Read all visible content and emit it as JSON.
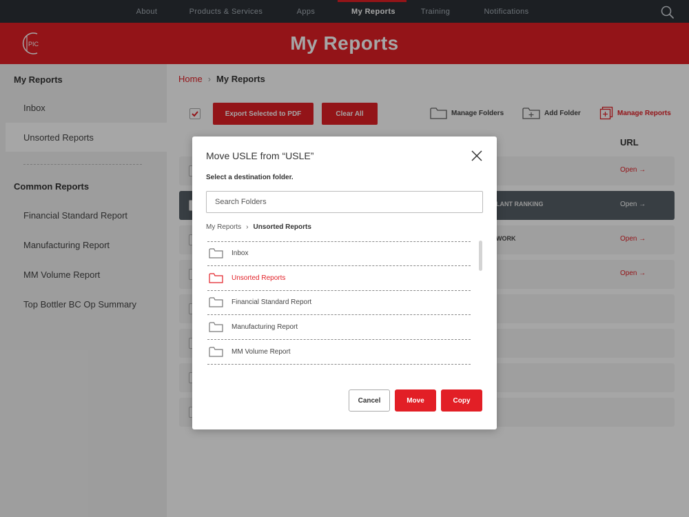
{
  "nav": {
    "items": [
      {
        "label": "About",
        "active": false
      },
      {
        "label": "Products & Services",
        "active": false
      },
      {
        "label": "Apps",
        "active": false
      },
      {
        "label": "My Reports",
        "active": true
      },
      {
        "label": "Training",
        "active": false
      },
      {
        "label": "Notifications",
        "active": false
      }
    ],
    "search_icon": "search-icon"
  },
  "header": {
    "logo_text": "PIC",
    "title": "My Reports"
  },
  "sidebar": {
    "my_reports_heading": "My Reports",
    "my_reports_items": [
      {
        "label": "Inbox"
      },
      {
        "label": "Unsorted Reports",
        "selected": true
      }
    ],
    "common_reports_heading": "Common Reports",
    "common_reports_items": [
      {
        "label": "Financial Standard Report"
      },
      {
        "label": "Manufacturing Report"
      },
      {
        "label": "MM Volume Report"
      },
      {
        "label": "Top Bottler BC Op Summary"
      }
    ]
  },
  "main": {
    "breadcrumb": {
      "home": "Home",
      "separator": "›",
      "current": "My Reports"
    },
    "toolbar": {
      "export_label": "Export Selected to PDF",
      "clear_label": "Clear All",
      "manage_folders_label": "Manage Folders",
      "add_folder_label": "Add Folder",
      "manage_reports_label": "Manage Reports"
    },
    "table": {
      "url_header": "URL",
      "rows": [
        {
          "name": "",
          "url": "Open →"
        },
        {
          "name": "LANT RANKING",
          "url": "Open →",
          "highlighted": true
        },
        {
          "name": "WORK",
          "url": "Open →"
        },
        {
          "name": "",
          "url": "Open →"
        },
        {
          "name": "",
          "url": ""
        },
        {
          "name": "",
          "url": ""
        },
        {
          "name": "",
          "url": ""
        },
        {
          "name": "",
          "url": ""
        }
      ]
    }
  },
  "modal": {
    "title": "Move USLE from “USLE”",
    "subtitle": "Select a destination folder.",
    "search_placeholder": "Search Folders",
    "breadcrumb_root": "My Reports",
    "breadcrumb_sep": "›",
    "breadcrumb_current": "Unsorted Reports",
    "folders": [
      {
        "label": "Inbox",
        "selected": false
      },
      {
        "label": "Unsorted Reports",
        "selected": true
      },
      {
        "label": "Financial Standard Report",
        "selected": false
      },
      {
        "label": "Manufacturing Report",
        "selected": false
      },
      {
        "label": "MM Volume Report",
        "selected": false
      }
    ],
    "cancel_label": "Cancel",
    "move_label": "Move",
    "copy_label": "Copy"
  },
  "colors": {
    "brand_red": "#e21f26",
    "nav_dark": "#2b3137",
    "highlight_row": "#566068"
  }
}
